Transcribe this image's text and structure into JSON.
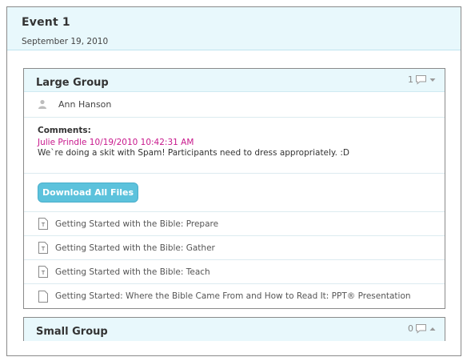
{
  "event": {
    "title": "Event 1",
    "date": "September 19, 2010"
  },
  "groups": [
    {
      "title": "Large Group",
      "comment_count": "1",
      "expanded": true,
      "leader": "Ann Hanson",
      "comments_label": "Comments:",
      "comment_author": "Julie Prindle 10/19/2010 10:42:31 AM",
      "comment_text": "We`re doing a skit with Spam! Participants need to dress appropriately. :D",
      "download_label": "Download All Files",
      "files": [
        {
          "name": "Getting Started with the Bible: Prepare",
          "icon": "text-document-icon"
        },
        {
          "name": "Getting Started with the Bible: Gather",
          "icon": "text-document-icon"
        },
        {
          "name": "Getting Started with the Bible: Teach",
          "icon": "text-document-icon"
        },
        {
          "name": "Getting Started: Where the Bible Came From and How to Read It: PPT® Presentation",
          "icon": "document-icon"
        }
      ]
    },
    {
      "title": "Small Group",
      "comment_count": "0",
      "expanded": false
    }
  ],
  "colors": {
    "header_bg": "#e8f8fc",
    "button_bg": "#5cc2dc",
    "comment_author": "#c8188c"
  }
}
